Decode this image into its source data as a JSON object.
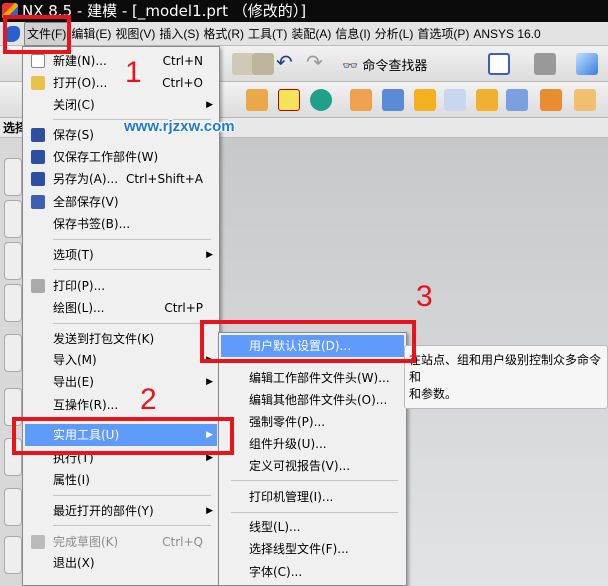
{
  "title": "NX 8.5 - 建模 - [_model1.prt （修改的）]",
  "menubar": [
    "文件(F)",
    "编辑(E)",
    "视图(V)",
    "插入(S)",
    "格式(R)",
    "工具(T)",
    "装配(A)",
    "信息(I)",
    "分析(L)",
    "首选项(P)",
    "ANSYS 16.0"
  ],
  "toolbar": {
    "command_finder": "命令查找器"
  },
  "selection_bar": "选择",
  "watermark": "www.rjzxw.com",
  "file_menu": [
    {
      "label": "新建(N)...",
      "shortcut": "Ctrl+N"
    },
    {
      "label": "打开(O)...",
      "shortcut": "Ctrl+O"
    },
    {
      "label": "关闭(C)"
    },
    {
      "label": "保存(S)"
    },
    {
      "label": "仅保存工作部件(W)"
    },
    {
      "label": "另存为(A)...",
      "shortcut": "Ctrl+Shift+A"
    },
    {
      "label": "全部保存(V)"
    },
    {
      "label": "保存书签(B)..."
    },
    {
      "label": "选项(T)"
    },
    {
      "label": "打印(P)..."
    },
    {
      "label": "绘图(L)...",
      "shortcut": "Ctrl+P"
    },
    {
      "label": "发送到打包文件(K)"
    },
    {
      "label": "导入(M)"
    },
    {
      "label": "导出(E)"
    },
    {
      "label": "互操作(R)..."
    },
    {
      "label": "实用工具(U)"
    },
    {
      "label": "执行(T)"
    },
    {
      "label": "属性(I)"
    },
    {
      "label": "最近打开的部件(Y)"
    },
    {
      "label": "完成草图(K)",
      "shortcut": "Ctrl+Q"
    },
    {
      "label": "退出(X)"
    }
  ],
  "utilities_submenu": [
    "用户默认设置(D)...",
    "编辑工作部件文件头(W)...",
    "编辑其他部件文件头(O)...",
    "强制零件(P)...",
    "组件升级(U)...",
    "定义可视报告(V)...",
    "打印机管理(I)...",
    "线型(L)...",
    "选择线型文件(F)...",
    "字体(C)..."
  ],
  "tooltip": [
    "在站点、组和用户级别控制众多命令和",
    "和参数。"
  ],
  "annotations": [
    "1",
    "2",
    "3"
  ],
  "colors": {
    "highlight": "#5f9bfb",
    "annotation_red": "#e8141c"
  }
}
